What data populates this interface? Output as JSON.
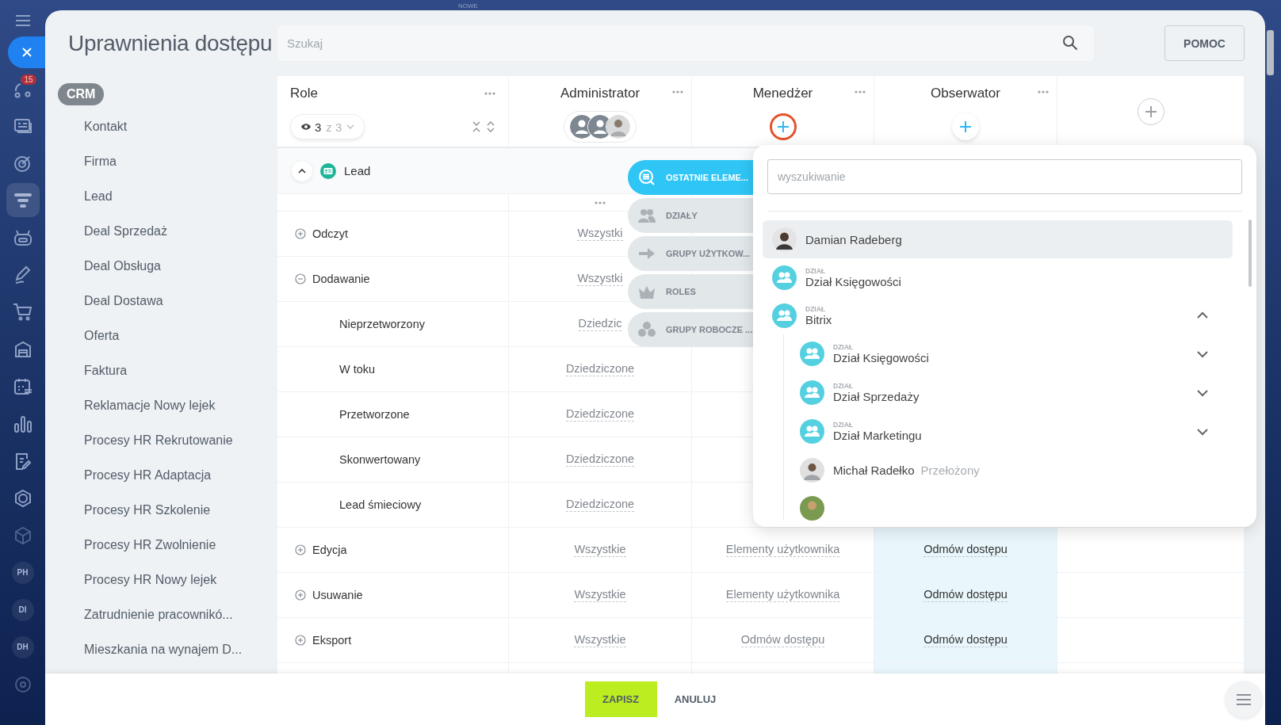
{
  "top_label": "NOWE",
  "rail": {
    "items": [
      {
        "kind": "flow",
        "selected": false,
        "badge": "15"
      },
      {
        "kind": "card",
        "selected": false
      },
      {
        "kind": "target",
        "selected": false
      },
      {
        "kind": "funnel",
        "selected": true
      },
      {
        "kind": "robot",
        "selected": false
      },
      {
        "kind": "pen",
        "selected": false
      },
      {
        "kind": "cart",
        "selected": false
      },
      {
        "kind": "store",
        "selected": false
      },
      {
        "kind": "calendar",
        "selected": false
      },
      {
        "kind": "chart",
        "selected": false
      },
      {
        "kind": "doc",
        "selected": false
      },
      {
        "kind": "hexagon",
        "selected": false
      },
      {
        "kind": "box",
        "selected": false
      },
      {
        "kind": "initials",
        "label": "PH",
        "selected": false
      },
      {
        "kind": "initials",
        "label": "DI",
        "selected": false
      },
      {
        "kind": "initials",
        "label": "DH",
        "selected": false
      },
      {
        "kind": "gear",
        "selected": false
      }
    ]
  },
  "header": {
    "title": "Uprawnienia dostępu",
    "search": {
      "placeholder": "Szukaj"
    },
    "help_button": "POMOC"
  },
  "sidebar": {
    "section": "CRM",
    "items": [
      {
        "label": "Kontakt"
      },
      {
        "label": "Firma"
      },
      {
        "label": "Lead"
      },
      {
        "label": "Deal Sprzedaż"
      },
      {
        "label": "Deal Obsługa"
      },
      {
        "label": "Deal Dostawa"
      },
      {
        "label": "Oferta"
      },
      {
        "label": "Faktura"
      },
      {
        "label": "Reklamacje Nowy lejek"
      },
      {
        "label": "Procesy HR Rekrutowanie"
      },
      {
        "label": "Procesy HR Adaptacja"
      },
      {
        "label": "Procesy HR Szkolenie"
      },
      {
        "label": "Procesy HR Zwolnienie"
      },
      {
        "label": "Procesy HR Nowy lejek"
      },
      {
        "label": "Zatrudnienie pracownikó..."
      },
      {
        "label": "Mieszkania na wynajem D..."
      }
    ]
  },
  "table": {
    "columns": [
      {
        "kind": "roles",
        "title": "Role",
        "filter": {
          "count": "3",
          "total": "z 3"
        }
      },
      {
        "kind": "role",
        "title": "Administrator",
        "members": [
          {
            "kind": "group"
          },
          {
            "kind": "group"
          },
          {
            "kind": "person"
          }
        ]
      },
      {
        "kind": "role",
        "title": "Menedżer",
        "add_highlighted": true
      },
      {
        "kind": "role",
        "title": "Obserwator",
        "add_highlighted": false,
        "highlighted": true
      },
      {
        "kind": "add"
      }
    ],
    "section": {
      "title": "Lead",
      "expanded": true
    },
    "rows": [
      {
        "kind": "action",
        "expanded": false,
        "cells": [
          "Odczyt",
          "Wszystki",
          null,
          null
        ]
      },
      {
        "kind": "action",
        "expanded": true,
        "cells": [
          "Dodawanie",
          "Wszystki",
          null,
          null
        ]
      },
      {
        "kind": "stage",
        "cells": [
          "Nieprzetworzony",
          "Dziedzic",
          null,
          null
        ]
      },
      {
        "kind": "stage",
        "cells": [
          "W toku",
          "Dziedziczone",
          null,
          null
        ]
      },
      {
        "kind": "stage",
        "cells": [
          "Przetworzone",
          "Dziedziczone",
          null,
          null
        ]
      },
      {
        "kind": "stage",
        "cells": [
          "Skonwertowany",
          "Dziedziczone",
          null,
          null
        ]
      },
      {
        "kind": "stage",
        "cells": [
          "Lead śmieciowy",
          "Dziedziczone",
          null,
          null
        ]
      },
      {
        "kind": "action",
        "expanded": false,
        "cells": [
          "Edycja",
          "Wszystkie",
          "Elementy użytkownika",
          "Odmów dostępu"
        ]
      },
      {
        "kind": "action",
        "expanded": false,
        "cells": [
          "Usuwanie",
          "Wszystkie",
          "Elementy użytkownika",
          "Odmów dostępu"
        ]
      },
      {
        "kind": "action",
        "expanded": false,
        "cells": [
          "Eksport",
          "Wszystkie",
          "Odmów dostępu",
          "Odmów dostępu"
        ]
      }
    ]
  },
  "picker_tabs": [
    {
      "kind": "recent",
      "label": "OSTATNIE ELEME...",
      "selected": true
    },
    {
      "kind": "departments",
      "label": "DZIAŁY",
      "selected": false
    },
    {
      "kind": "groups",
      "label": "GRUPY UŻYTKOW...",
      "selected": false
    },
    {
      "kind": "roles",
      "label": "ROLES",
      "selected": false
    },
    {
      "kind": "workgroups",
      "label": "GRUPY ROBOCZE ...",
      "selected": false
    }
  ],
  "picker": {
    "search": {
      "placeholder": "wyszukiwanie"
    },
    "items": [
      {
        "kind": "person",
        "name": "Damian Radeberg",
        "selected": true
      },
      {
        "kind": "department",
        "caption": "DZIAŁ",
        "name": "Dział Księgowości",
        "selected": false
      },
      {
        "kind": "department",
        "caption": "DZIAŁ",
        "name": "Bitrix",
        "selected": false,
        "expanded": true,
        "children": [
          {
            "kind": "department",
            "caption": "DZIAŁ",
            "name": "Dział Księgowości",
            "selected": false,
            "expanded": false
          },
          {
            "kind": "department",
            "caption": "DZIAŁ",
            "name": "Dział Sprzedaży",
            "selected": false,
            "expanded": false
          },
          {
            "kind": "department",
            "caption": "DZIAŁ",
            "name": "Dział Marketingu",
            "selected": false,
            "expanded": false
          },
          {
            "kind": "person",
            "name": "Michał Radełko",
            "note": "Przełożony",
            "selected": false
          },
          {
            "kind": "avatar-only",
            "selected": false
          }
        ]
      }
    ]
  },
  "footer": {
    "save": "ZAPISZ",
    "cancel": "ANULUJ"
  }
}
